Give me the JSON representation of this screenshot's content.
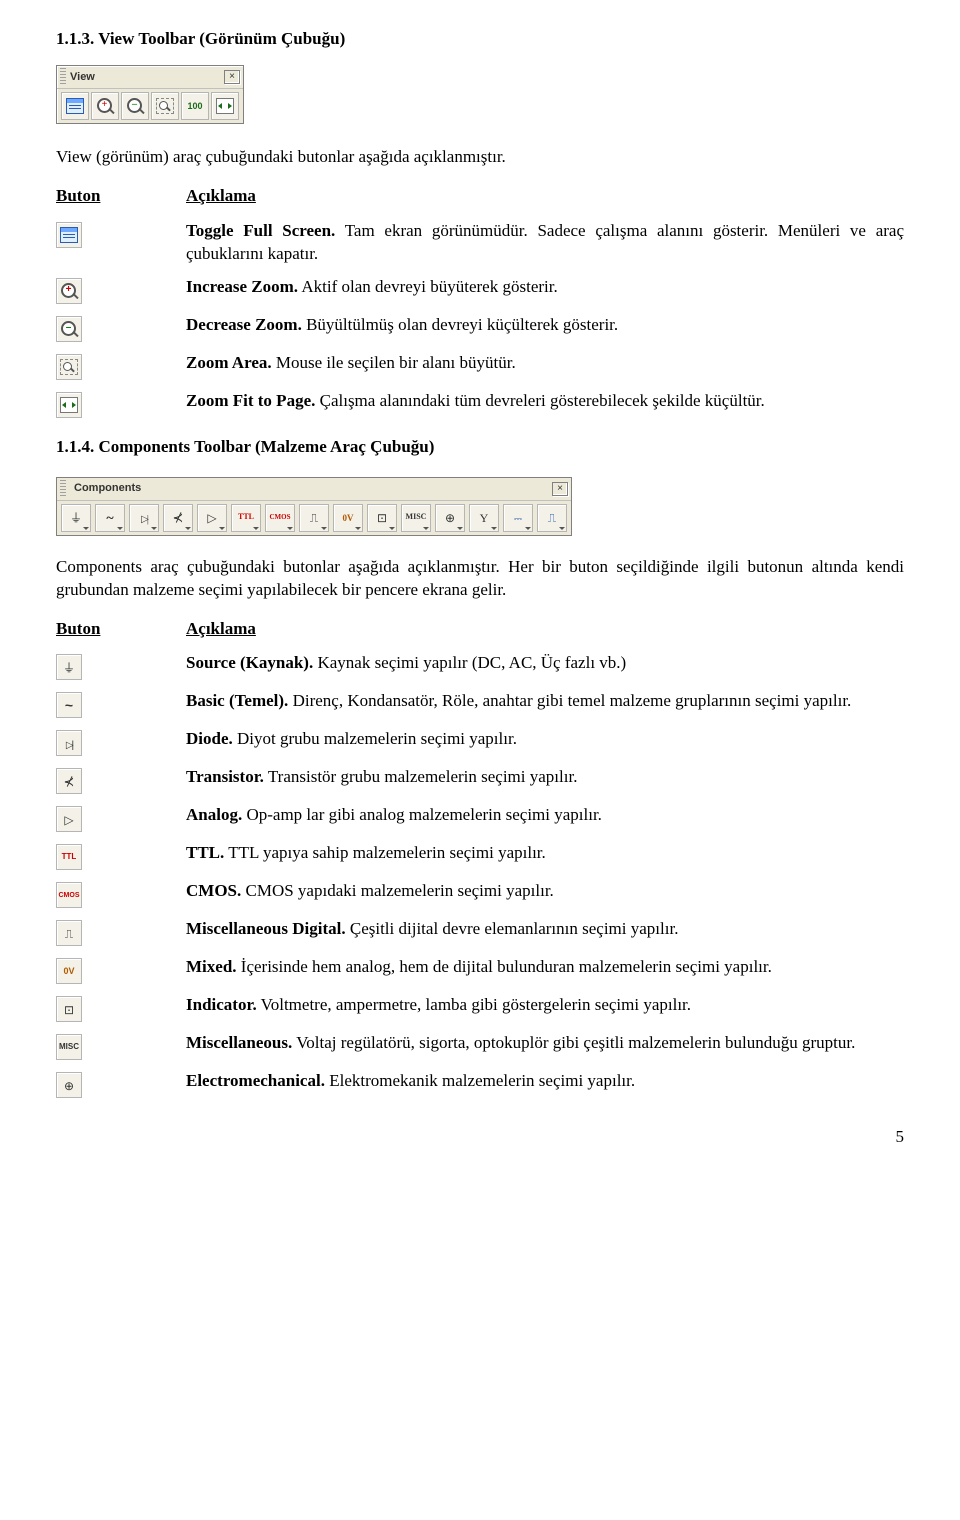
{
  "section113": {
    "heading": "1.1.3. View Toolbar (Görünüm Çubuğu)",
    "toolbar_title": "View",
    "intro": "View (görünüm) araç çubuğundaki butonlar aşağıda açıklanmıştır.",
    "col_button": "Buton",
    "col_desc": "Açıklama",
    "items": [
      {
        "bold": "Toggle Full Screen.",
        "rest": " Tam ekran görünümüdür. Sadece çalışma alanını gösterir. Menüleri ve araç çubuklarını kapatır."
      },
      {
        "bold": "Increase Zoom.",
        "rest": " Aktif olan devreyi büyüterek gösterir."
      },
      {
        "bold": "Decrease Zoom.",
        "rest": " Büyültülmüş olan devreyi küçülterek gösterir."
      },
      {
        "bold": "Zoom Area.",
        "rest": " Mouse ile seçilen bir alanı büyütür."
      },
      {
        "bold": "Zoom Fit to Page.",
        "rest": " Çalışma alanındaki tüm devreleri gösterebilecek şekilde küçültür."
      }
    ],
    "label_100": "100"
  },
  "section114": {
    "heading": "1.1.4. Components Toolbar (Malzeme Araç Çubuğu)",
    "toolbar_title": "Components",
    "intro": "Components araç çubuğundaki butonlar aşağıda açıklanmıştır. Her bir buton seçildiğinde ilgili butonun altında kendi grubundan malzeme seçimi yapılabilecek bir pencere ekrana gelir.",
    "col_button": "Buton",
    "col_desc": "Açıklama",
    "labels": {
      "ttl": "TTL",
      "cmos": "CMOS",
      "mixed": "0V",
      "misc": "MISC"
    },
    "items": [
      {
        "bold": "Source (Kaynak).",
        "rest": " Kaynak seçimi yapılır (DC, AC, Üç fazlı vb.)"
      },
      {
        "bold": "Basic (Temel).",
        "rest": " Direnç, Kondansatör, Röle, anahtar gibi temel malzeme gruplarının seçimi yapılır."
      },
      {
        "bold": "Diode.",
        "rest": " Diyot grubu malzemelerin seçimi yapılır."
      },
      {
        "bold": "Transistor.",
        "rest": " Transistör grubu malzemelerin seçimi yapılır."
      },
      {
        "bold": "Analog.",
        "rest": " Op-amp lar gibi analog malzemelerin seçimi yapılır."
      },
      {
        "bold": "TTL.",
        "rest": " TTL yapıya sahip malzemelerin seçimi yapılır."
      },
      {
        "bold": "CMOS.",
        "rest": " CMOS yapıdaki malzemelerin seçimi yapılır."
      },
      {
        "bold": "Miscellaneous Digital.",
        "rest": " Çeşitli dijital devre elemanlarının seçimi yapılır."
      },
      {
        "bold": "Mixed.",
        "rest": " İçerisinde hem analog, hem de dijital bulunduran malzemelerin seçimi yapılır."
      },
      {
        "bold": "Indicator.",
        "rest": " Voltmetre, ampermetre, lamba gibi göstergelerin seçimi yapılır."
      },
      {
        "bold": "Miscellaneous.",
        "rest": " Voltaj regülatörü, sigorta, optokuplör gibi çeşitli malzemelerin bulunduğu gruptur."
      },
      {
        "bold": "Electromechanical.",
        "rest": " Elektromekanik malzemelerin seçimi yapılır."
      }
    ]
  },
  "page_number": "5"
}
